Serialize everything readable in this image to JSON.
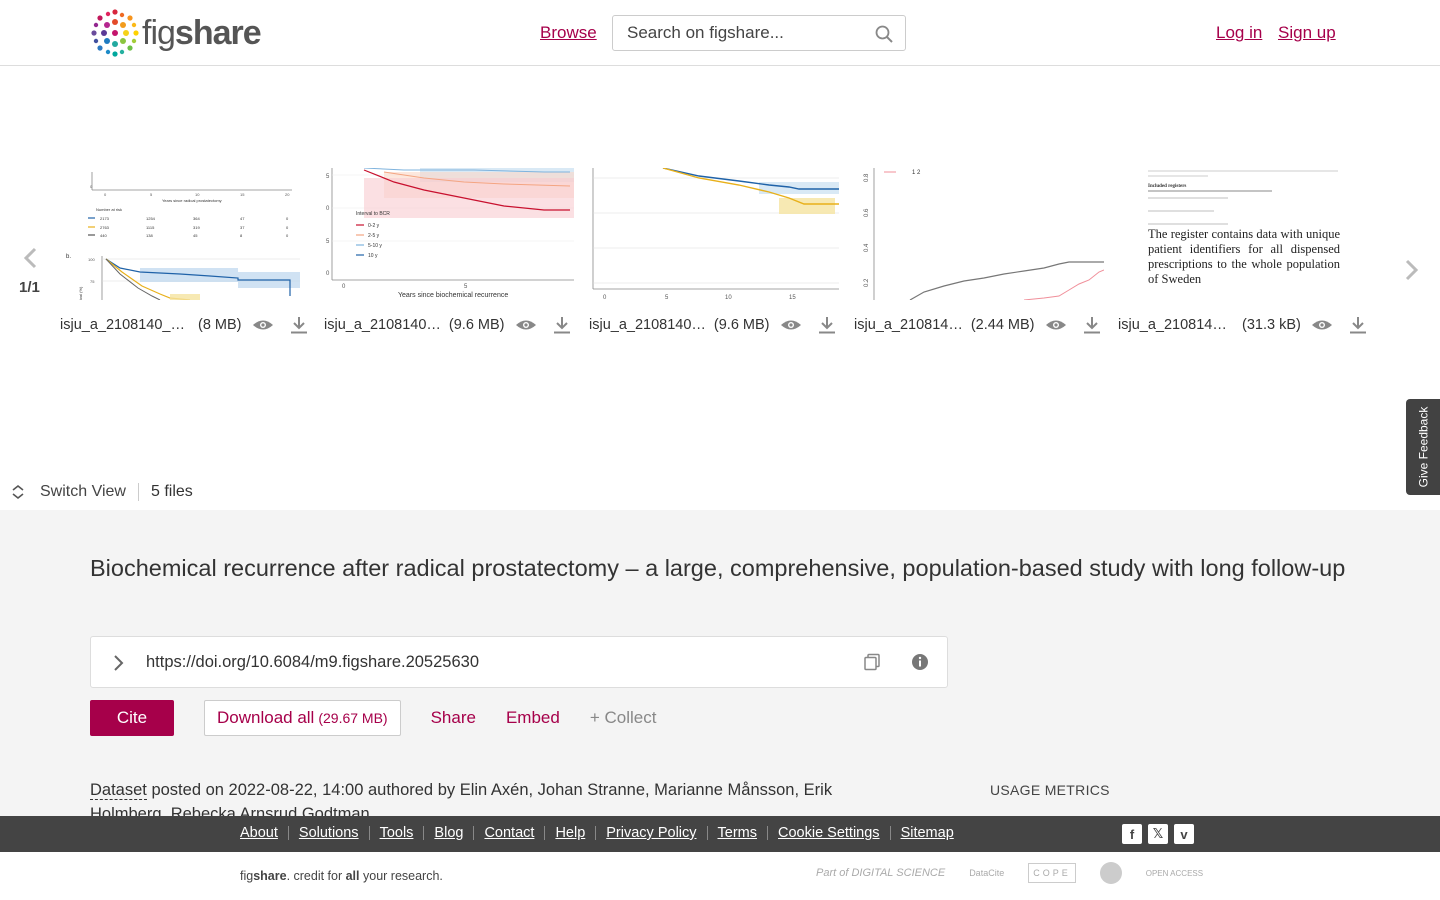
{
  "header": {
    "logo_text_light": "fig",
    "logo_text_bold": "share",
    "browse_label": "Browse",
    "search_placeholder": "Search on figshare...",
    "login_label": "Log in",
    "signup_label": "Sign up"
  },
  "carousel": {
    "page_indicator": "1/1",
    "files": [
      {
        "name": "isju_a_2108140_s…",
        "size": "(8 MB)"
      },
      {
        "name": "isju_a_2108140…",
        "size": "(9.6 MB)"
      },
      {
        "name": "isju_a_2108140…",
        "size": "(9.6 MB)"
      },
      {
        "name": "isju_a_210814…",
        "size": "(2.44 MB)"
      },
      {
        "name": "isju_a_2108140…",
        "size": "(31.3 kB)"
      }
    ],
    "thumb_texts": {
      "t1_xlabel": "Years since radical prostatectomy",
      "t1_risk": "Number at risk",
      "t1_panel": "b.",
      "t2_legend_title": "Interval to BCR",
      "t2_legend": [
        "0-2 y",
        "2-5 y",
        "5-10 y",
        "10 y"
      ],
      "t2_xlabel": "Years since biochemical recurrence",
      "t5_header": "Included registers",
      "t5_body": "The register contains data with unique patient identifiers for all dispensed prescriptions to the whole population of Sweden"
    }
  },
  "feedback_label": "Give Feedback",
  "view": {
    "switch_label": "Switch View",
    "files_count": "5 files"
  },
  "item": {
    "title": "Biochemical recurrence after radical prostatectomy – a large, comprehensive, population-based study with long follow-up",
    "doi": "https://doi.org/10.6084/m9.figshare.20525630",
    "cite_label": "Cite",
    "download_label": "Download all",
    "download_size": "(29.67 MB)",
    "share_label": "Share",
    "embed_label": "Embed",
    "collect_label": "+ Collect",
    "type_label": "Dataset",
    "posted_text": " posted on 2022-08-22, 14:00 authored by Elin Axén, Johan Stranne, Marianne Månsson, Erik Holmberg, Rebecka Arnsrud Godtman",
    "usage_metrics": "USAGE METRICS"
  },
  "footer": {
    "links": [
      "About",
      "Solutions",
      "Tools",
      "Blog",
      "Contact",
      "Help",
      "Privacy Policy",
      "Terms",
      "Cookie Settings",
      "Sitemap"
    ],
    "tagline_pre": "fig",
    "tagline_bold": "share",
    "tagline_mid": ". credit for ",
    "tagline_all": "all",
    "tagline_end": " your research.",
    "partners": [
      "Part of DIGITAL SCIENCE",
      "DataCite",
      "COPE",
      "",
      "OPEN ACCESS"
    ]
  },
  "colors": {
    "brand": "#a6004a",
    "footer_bg": "#444444",
    "main_bg": "#f4f4f4"
  }
}
